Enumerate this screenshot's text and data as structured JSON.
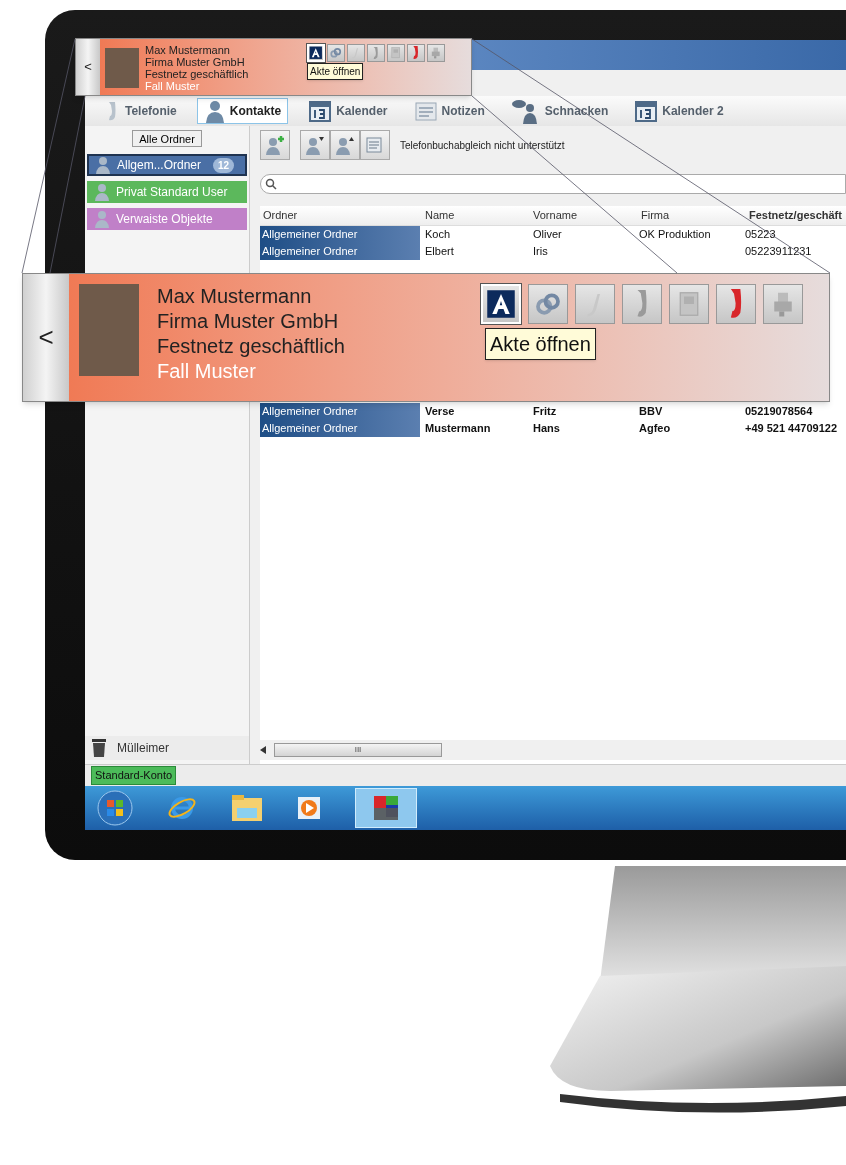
{
  "small_popup": {
    "back": "<",
    "lines": [
      "Max Mustermann",
      "Firma Muster GmbH",
      "Festnetz geschäftlich"
    ],
    "case": "Fall Muster",
    "tooltip": "Akte öffnen",
    "actions": [
      {
        "kind": "file",
        "selected": true
      },
      {
        "kind": "link",
        "selected": false
      },
      {
        "kind": "note",
        "selected": false
      },
      {
        "kind": "phone",
        "selected": false
      },
      {
        "kind": "device",
        "selected": false
      },
      {
        "kind": "call",
        "selected": false
      },
      {
        "kind": "fax",
        "selected": false
      }
    ]
  },
  "magnified_popup": {
    "back": "<",
    "lines": [
      "Max Mustermann",
      "Firma Muster GmbH",
      "Festnetz geschäftlich"
    ],
    "case": "Fall Muster",
    "tooltip": "Akte öffnen",
    "actions": [
      {
        "kind": "file",
        "selected": true
      },
      {
        "kind": "link",
        "selected": false
      },
      {
        "kind": "note",
        "selected": false
      },
      {
        "kind": "phone",
        "selected": false
      },
      {
        "kind": "device",
        "selected": false
      },
      {
        "kind": "call",
        "selected": false
      },
      {
        "kind": "fax",
        "selected": false
      }
    ]
  },
  "tabs": [
    {
      "label": "Telefonie",
      "kind": "phone",
      "selected": false
    },
    {
      "label": "Kontakte",
      "kind": "contacts",
      "selected": true
    },
    {
      "label": "Kalender",
      "kind": "calendar",
      "selected": false
    },
    {
      "label": "Notizen",
      "kind": "notes",
      "selected": false
    },
    {
      "label": "Schnacken",
      "kind": "chat",
      "selected": false
    },
    {
      "label": "Kalender 2",
      "kind": "calendar",
      "selected": false
    }
  ],
  "sidebar": {
    "all_button": "Alle Ordner",
    "folders": [
      {
        "label": "Allgem...Ordner",
        "count": "12",
        "color": "#4a6fa5",
        "selected": true
      },
      {
        "label": "Privat Standard User",
        "color": "#5cb85c",
        "selected": false
      },
      {
        "label": "Verwaiste Objekte",
        "color": "#c080c8",
        "selected": false
      }
    ],
    "trash": "Mülleimer"
  },
  "toolbar": {
    "sync_status": "Telefonbuchabgleich nicht unterstützt"
  },
  "table": {
    "columns": [
      "Ordner",
      "Name",
      "Vorname",
      "Firma",
      "Festnetz/geschäft"
    ],
    "rows_top": [
      {
        "folder": "Allgemeiner Ordner",
        "name": "Koch",
        "first_name": "Oliver",
        "company": "OK Produktion",
        "phone": "05223"
      },
      {
        "folder": "Allgemeiner Ordner",
        "name": "Elbert",
        "first_name": "Iris",
        "phone": "05223911231"
      }
    ],
    "rows_bottom": [
      {
        "folder": "Allgemeiner Ordner",
        "name": "Verse",
        "first_name": "Fritz",
        "company": "BBV",
        "phone": "05219078564"
      },
      {
        "folder": "Allgemeiner Ordner",
        "name": "Mustermann",
        "first_name": "Hans",
        "company": "Agfeo",
        "phone": "+49 521 44709122"
      }
    ],
    "scrollbar_grip": "III"
  },
  "status_bar": {
    "account": "Standard-Konto"
  }
}
